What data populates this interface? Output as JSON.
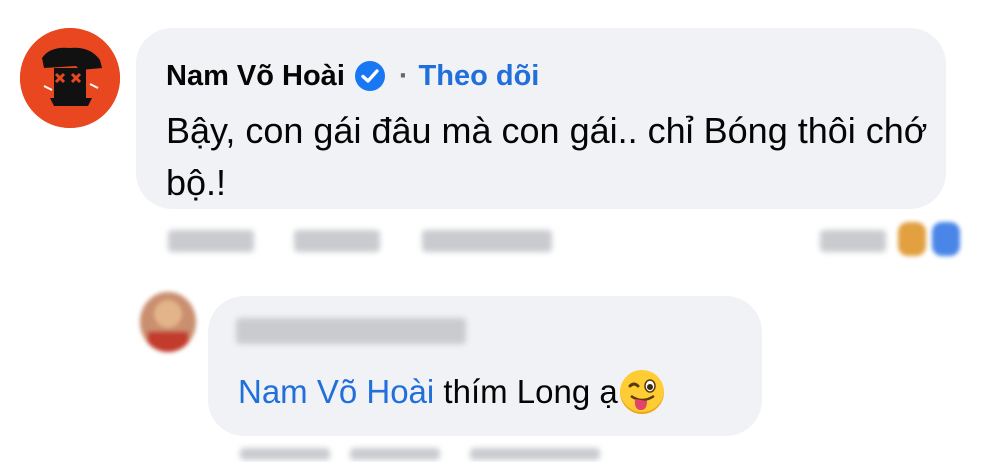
{
  "comment": {
    "author": "Nam Võ Hoài",
    "separator": "·",
    "follow_label": "Theo dõi",
    "text": "Bậy, con gái đâu mà con gái.. chỉ Bóng thôi chớ bộ.!",
    "avatar_icon": "graffiti-avatar",
    "verified_icon": "verified-badge-icon"
  },
  "reply": {
    "mention": "Nam Võ Hoài",
    "text": " thím Long ạ",
    "emoji_icon": "winking-tongue-emoji"
  },
  "colors": {
    "bubble": "#f0f2f5",
    "link": "#216fdb",
    "verified": "#1877f2",
    "avatar": "#e8471f"
  }
}
